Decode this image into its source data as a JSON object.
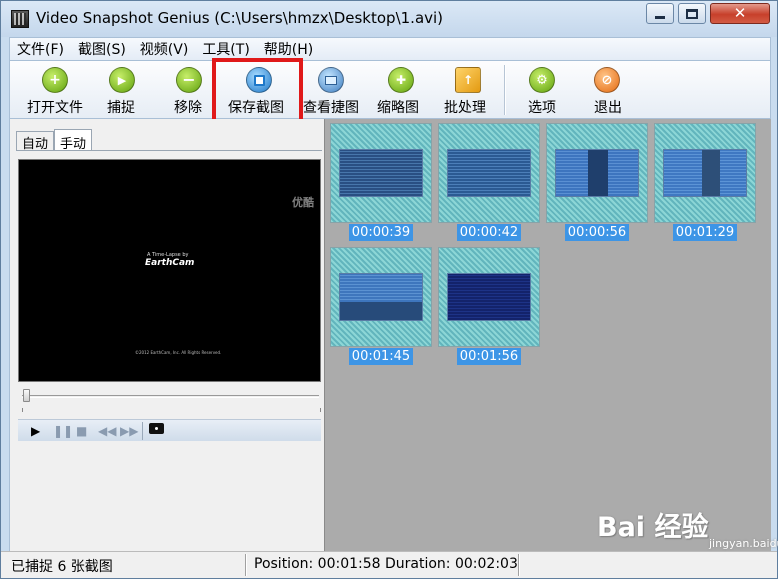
{
  "window": {
    "title": "Video Snapshot Genius (C:\\Users\\hmzx\\Desktop\\1.avi)"
  },
  "menu": [
    {
      "label": "文件(F)"
    },
    {
      "label": "截图(S)"
    },
    {
      "label": "视频(V)"
    },
    {
      "label": "工具(T)"
    },
    {
      "label": "帮助(H)"
    }
  ],
  "toolbar": {
    "buttons": [
      {
        "label": "打开文件",
        "icon": "plus-icon",
        "color": "#7cbe1e"
      },
      {
        "label": "捕捉",
        "icon": "play-icon",
        "color": "#7cbe1e"
      },
      {
        "label": "移除",
        "icon": "minus-icon",
        "color": "#7cbe1e"
      },
      {
        "label": "保存截图",
        "icon": "floppy-icon",
        "color": "#2e8fd8"
      },
      {
        "label": "查看捷图",
        "icon": "monitor-icon",
        "color": "#2e8fd8"
      },
      {
        "label": "缩略图",
        "icon": "puzzle-icon",
        "color": "#7cbe1e"
      },
      {
        "label": "批处理",
        "icon": "batch-icon",
        "color": "#e8a21a"
      },
      {
        "label": "选项",
        "icon": "wrench-icon",
        "color": "#7cbe1e"
      },
      {
        "label": "退出",
        "icon": "stop-icon",
        "color": "#ef7b1f"
      }
    ],
    "highlight_color": "#e0191a"
  },
  "tabs": [
    {
      "label": "自动",
      "active": false
    },
    {
      "label": "手动",
      "active": true
    }
  ],
  "video": {
    "watermark": "优酷",
    "small_caption": "A Time-Lapse by",
    "logo": "EarthCam",
    "copyright": "©2012 EarthCam, Inc. All Rights Reserved."
  },
  "playback_controls": [
    "play-icon",
    "pause-icon",
    "stop-icon",
    "rewind-icon",
    "fast-forward-icon",
    "camera-icon"
  ],
  "snapshots": [
    {
      "time": "00:00:39"
    },
    {
      "time": "00:00:42"
    },
    {
      "time": "00:00:56"
    },
    {
      "time": "00:01:29"
    },
    {
      "time": "00:01:45"
    },
    {
      "time": "00:01:56"
    }
  ],
  "statusbar": {
    "captured": "已捕捉 6 张截图",
    "position": "Position: 00:01:58 Duration: 00:02:03"
  },
  "watermark": {
    "brand": "Bai 经验",
    "url": "jingyan.baidu.com"
  }
}
